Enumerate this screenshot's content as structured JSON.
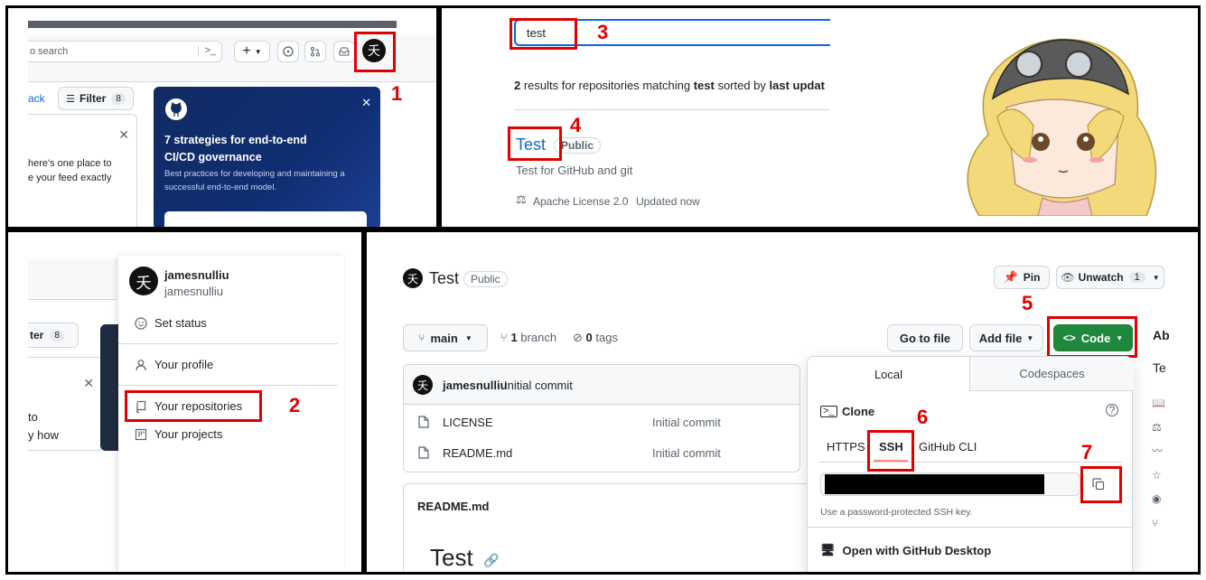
{
  "steps": [
    "1",
    "2",
    "3",
    "4",
    "5",
    "6",
    "7"
  ],
  "p1": {
    "search_placeholder": "o search",
    "cmd_key": ">_",
    "back_link": "ack",
    "filter_label": "Filter",
    "filter_count": "8",
    "feed_line1": "here's one place to",
    "feed_line2": "e your feed exactly",
    "promo_title_1": "7 strategies for end-to-end",
    "promo_title_2": "CI/CD governance",
    "promo_desc_1": "Best practices for developing and maintaining a",
    "promo_desc_2": "successful end-to-end model."
  },
  "p2": {
    "search_value": "test",
    "results_prefix": "2",
    "results_mid": " results for repositories matching ",
    "results_term": "test",
    "results_suffix": " sorted by ",
    "results_sort": "last updat",
    "repo_name": "Test",
    "repo_visibility": "Public",
    "repo_desc": "Test for GitHub and git",
    "license": "Apache License 2.0",
    "updated": "Updated now"
  },
  "p3": {
    "filter_partial": "ter",
    "filter_count": "8",
    "feed_partial_1": "to",
    "feed_partial_2": "y how",
    "username": "jamesnulliu",
    "handle": "jamesnulliu",
    "menu": [
      "Set status",
      "Your profile",
      "Your repositories",
      "Your projects"
    ]
  },
  "p4": {
    "repo_name": "Test",
    "visibility": "Public",
    "pin_label": "Pin",
    "unwatch_label": "Unwatch",
    "watch_count": "1",
    "branch_name": "main",
    "branches_count": "1",
    "branches_label": "branch",
    "tags_count": "0",
    "tags_label": "tags",
    "go_to_file": "Go to file",
    "add_file": "Add file",
    "code_label": "Code",
    "commit_author": "jamesnulliu",
    "commit_msg": "Initial commit",
    "files": [
      {
        "name": "LICENSE",
        "commit": "Initial commit"
      },
      {
        "name": "README.md",
        "commit": "Initial commit"
      }
    ],
    "readme_header": "README.md",
    "readme_title": "Test",
    "side_about": "Ab",
    "side_desc": "Te",
    "popup": {
      "tab_local": "Local",
      "tab_codespaces": "Codespaces",
      "clone_label": "Clone",
      "sub_tabs": [
        "HTTPS",
        "SSH",
        "GitHub CLI"
      ],
      "ssh_hint": "Use a password-protected SSH key.",
      "desktop_label": "Open with GitHub Desktop"
    }
  },
  "colors": {
    "highlight": "#e00000",
    "code_button": "#1f883d",
    "link": "#0969da",
    "promo_bg": "#0d2a66"
  }
}
